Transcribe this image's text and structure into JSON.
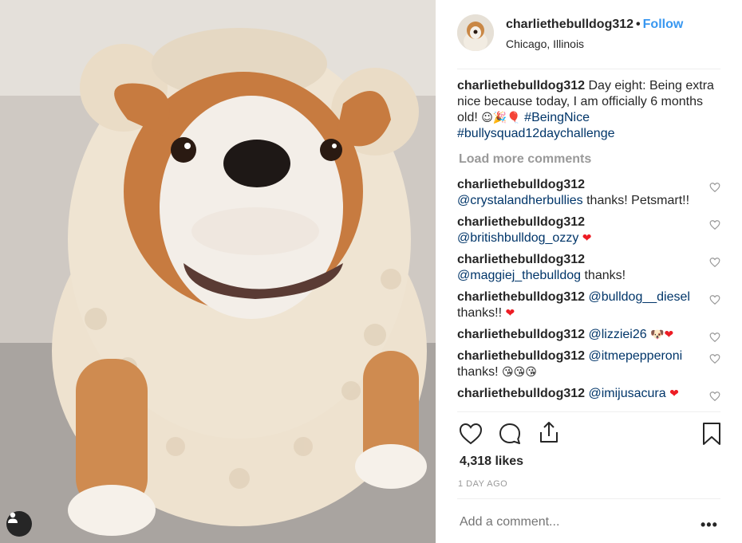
{
  "post": {
    "username": "charliethebulldog312",
    "separator": "•",
    "follow_label": "Follow",
    "location": "Chicago, Illinois",
    "caption": {
      "username": "charliethebulldog312",
      "text": "Day eight: Being extra nice because today, I am officially 6 months old!",
      "emojis": "☺🎉🎈",
      "hashtags": [
        "#BeingNice",
        "#bullysquad12daychallenge"
      ]
    },
    "load_more_label": "Load more comments",
    "comments": [
      {
        "username": "charliethebulldog312",
        "mention": "@crystalandherbullies",
        "text": "thanks! Petsmart!!",
        "emoji": ""
      },
      {
        "username": "charliethebulldog312",
        "mention": "@britishbulldog_ozzy",
        "text": "",
        "emoji": "❤"
      },
      {
        "username": "charliethebulldog312",
        "mention": "@maggiej_thebulldog",
        "text": "thanks!",
        "emoji": ""
      },
      {
        "username": "charliethebulldog312",
        "mention": "@bulldog__diesel",
        "text": "thanks!!",
        "emoji": "❤"
      },
      {
        "username": "charliethebulldog312",
        "mention": "@lizziei26",
        "text": "",
        "emoji": "🐶❤"
      },
      {
        "username": "charliethebulldog312",
        "mention": "@itmepepperoni",
        "text": "thanks!",
        "emoji": "😘😘😘"
      },
      {
        "username": "charliethebulldog312",
        "mention": "@imijusacura",
        "text": "",
        "emoji": "❤"
      }
    ],
    "likes": "4,318 likes",
    "time": "1 DAY AGO",
    "add_comment_placeholder": "Add a comment...",
    "more_options": "•••"
  },
  "icons": {
    "like": "heart-icon",
    "comment": "comment-bubble-icon",
    "share": "share-icon",
    "save": "bookmark-icon",
    "comment_like": "heart-icon",
    "user_tag": "user-icon"
  },
  "colors": {
    "link": "#3897f0",
    "hashtag": "#003569",
    "muted": "#999999",
    "heart_red": "#ed1c24"
  }
}
